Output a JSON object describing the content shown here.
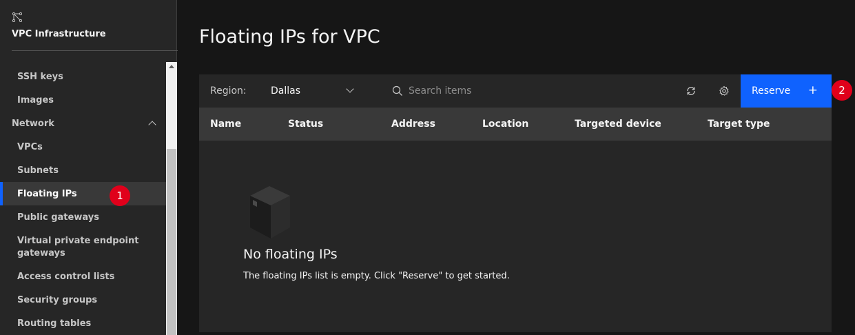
{
  "sidebar": {
    "title": "VPC Infrastructure",
    "logo_icon": "vpc-network-icon",
    "items": [
      {
        "label": "SSH keys"
      },
      {
        "label": "Images"
      },
      {
        "label": "Network"
      },
      {
        "label": "VPCs"
      },
      {
        "label": "Subnets"
      },
      {
        "label": "Floating IPs"
      },
      {
        "label": "Public gateways"
      },
      {
        "label": "Virtual private endpoint gateways"
      },
      {
        "label": "Access control lists"
      },
      {
        "label": "Security groups"
      },
      {
        "label": "Routing tables"
      }
    ]
  },
  "annotations": {
    "badge1": "1",
    "badge2": "2"
  },
  "page": {
    "title": "Floating IPs for VPC"
  },
  "toolbar": {
    "region_label": "Region:",
    "region_value": "Dallas",
    "search_placeholder": "Search items",
    "refresh_icon": "refresh-icon",
    "settings_icon": "gear-icon",
    "reserve_label": "Reserve",
    "reserve_plus": "+"
  },
  "table": {
    "columns": [
      "Name",
      "Status",
      "Address",
      "Location",
      "Targeted device",
      "Target type"
    ]
  },
  "empty_state": {
    "icon": "box-icon",
    "title": "No floating IPs",
    "text": "The floating IPs list is empty. Click \"Reserve\" to get started."
  },
  "colors": {
    "accent": "#0f62fe",
    "badge": "#e0001b",
    "active_bg": "#393939"
  }
}
